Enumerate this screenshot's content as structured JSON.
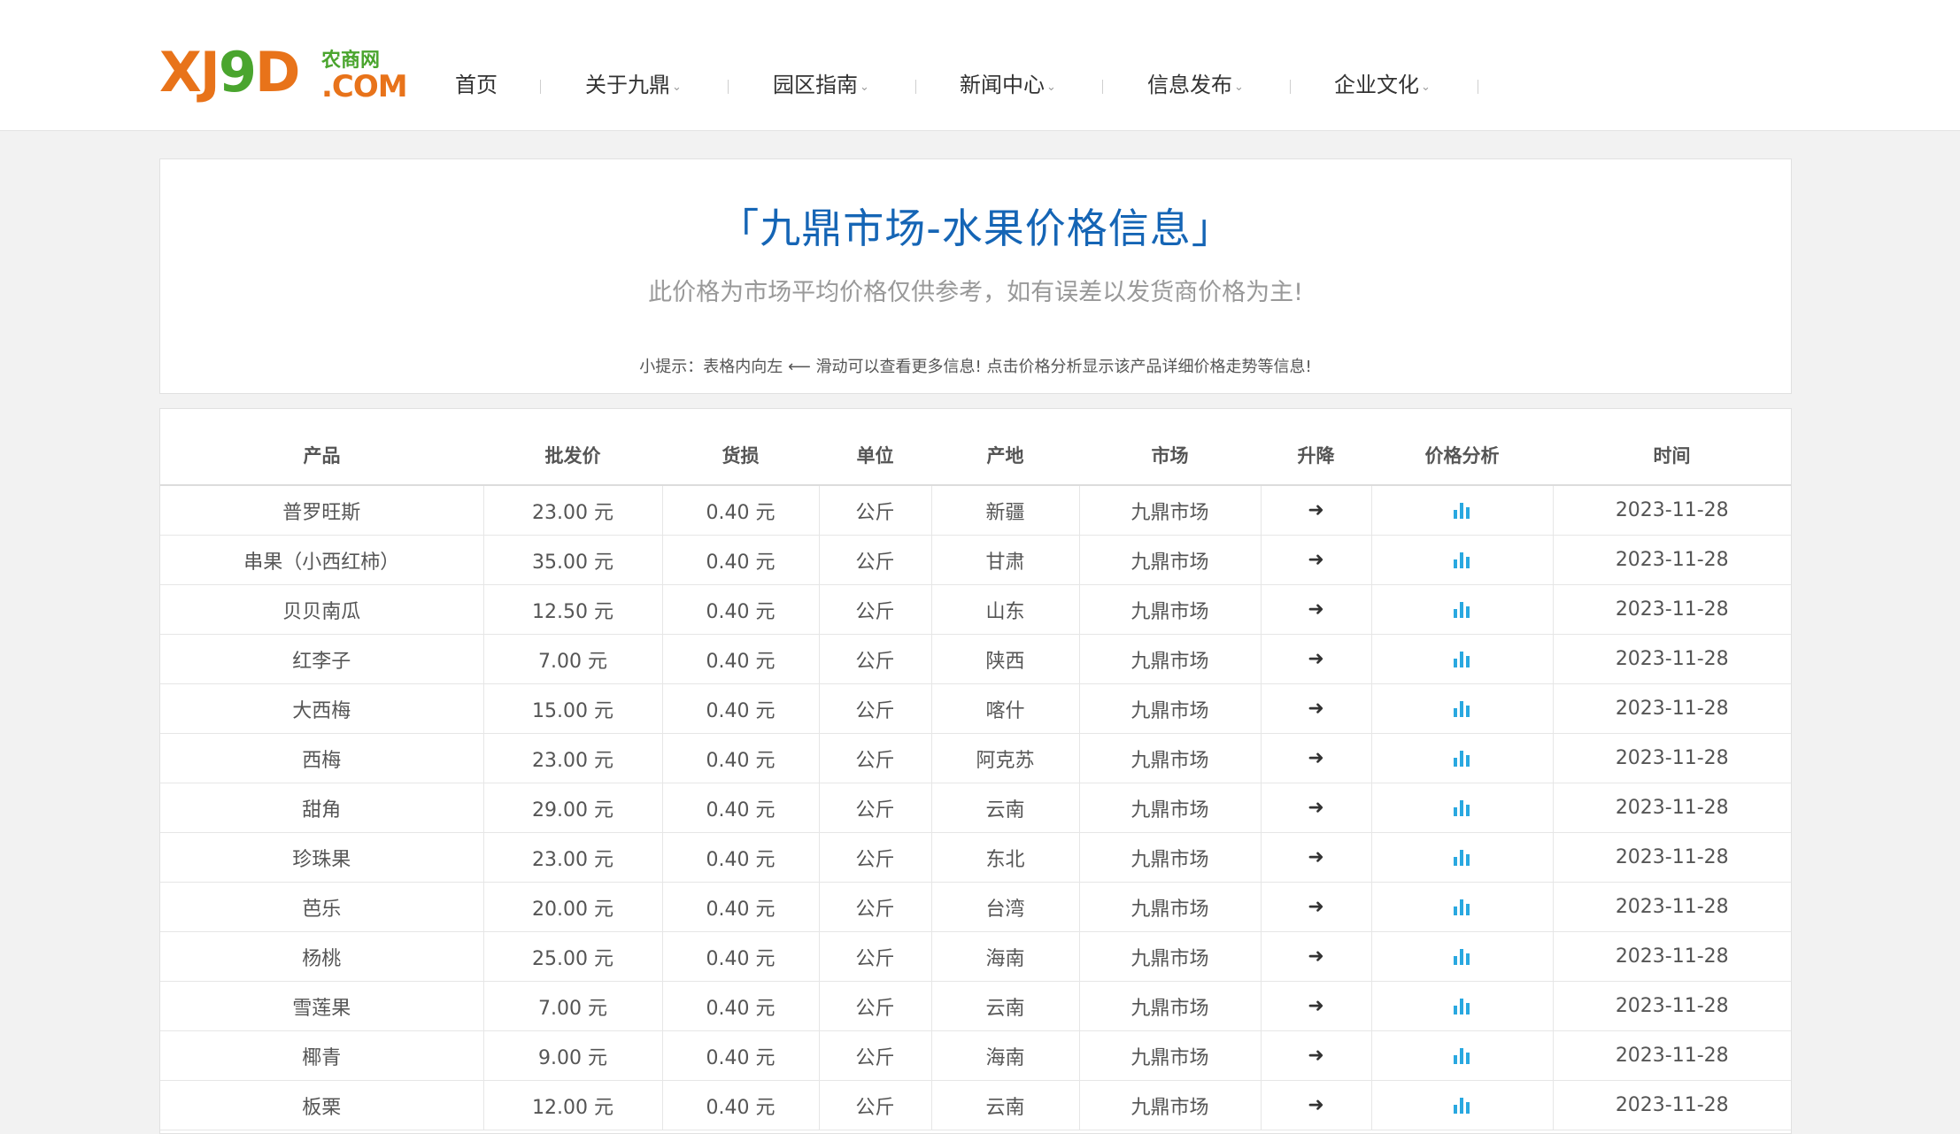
{
  "logo": {
    "main_left": "XJ",
    "main_nine": "9",
    "main_right": "D",
    "sub_top": "农商网",
    "sub_bottom": ".COM"
  },
  "nav": {
    "items": [
      {
        "label": "首页",
        "dropdown": false
      },
      {
        "label": "关于九鼎",
        "dropdown": true
      },
      {
        "label": "园区指南",
        "dropdown": true
      },
      {
        "label": "新闻中心",
        "dropdown": true
      },
      {
        "label": "信息发布",
        "dropdown": true
      },
      {
        "label": "企业文化",
        "dropdown": true
      }
    ],
    "caret": "⌄"
  },
  "header": {
    "title": "「九鼎市场-水果价格信息」",
    "subtitle": "此价格为市场平均价格仅供参考，如有误差以发货商价格为主!",
    "tip": "小提示：表格内向左 ⟵ 滑动可以查看更多信息! 点击价格分析显示该产品详细价格走势等信息!"
  },
  "table": {
    "columns": [
      "产品",
      "批发价",
      "货损",
      "单位",
      "产地",
      "市场",
      "升降",
      "价格分析",
      "时间"
    ],
    "rows": [
      {
        "product": "普罗旺斯",
        "price": "23.00 元",
        "loss": "0.40 元",
        "unit": "公斤",
        "origin": "新疆",
        "market": "九鼎市场",
        "trend": "➜",
        "date": "2023-11-28"
      },
      {
        "product": "串果（小西红柿）",
        "price": "35.00 元",
        "loss": "0.40 元",
        "unit": "公斤",
        "origin": "甘肃",
        "market": "九鼎市场",
        "trend": "➜",
        "date": "2023-11-28"
      },
      {
        "product": "贝贝南瓜",
        "price": "12.50 元",
        "loss": "0.40 元",
        "unit": "公斤",
        "origin": "山东",
        "market": "九鼎市场",
        "trend": "➜",
        "date": "2023-11-28"
      },
      {
        "product": "红李子",
        "price": "7.00 元",
        "loss": "0.40 元",
        "unit": "公斤",
        "origin": "陕西",
        "market": "九鼎市场",
        "trend": "➜",
        "date": "2023-11-28"
      },
      {
        "product": "大西梅",
        "price": "15.00 元",
        "loss": "0.40 元",
        "unit": "公斤",
        "origin": "喀什",
        "market": "九鼎市场",
        "trend": "➜",
        "date": "2023-11-28"
      },
      {
        "product": "西梅",
        "price": "23.00 元",
        "loss": "0.40 元",
        "unit": "公斤",
        "origin": "阿克苏",
        "market": "九鼎市场",
        "trend": "➜",
        "date": "2023-11-28"
      },
      {
        "product": "甜角",
        "price": "29.00 元",
        "loss": "0.40 元",
        "unit": "公斤",
        "origin": "云南",
        "market": "九鼎市场",
        "trend": "➜",
        "date": "2023-11-28"
      },
      {
        "product": "珍珠果",
        "price": "23.00 元",
        "loss": "0.40 元",
        "unit": "公斤",
        "origin": "东北",
        "market": "九鼎市场",
        "trend": "➜",
        "date": "2023-11-28"
      },
      {
        "product": "芭乐",
        "price": "20.00 元",
        "loss": "0.40 元",
        "unit": "公斤",
        "origin": "台湾",
        "market": "九鼎市场",
        "trend": "➜",
        "date": "2023-11-28"
      },
      {
        "product": "杨桃",
        "price": "25.00 元",
        "loss": "0.40 元",
        "unit": "公斤",
        "origin": "海南",
        "market": "九鼎市场",
        "trend": "➜",
        "date": "2023-11-28"
      },
      {
        "product": "雪莲果",
        "price": "7.00 元",
        "loss": "0.40 元",
        "unit": "公斤",
        "origin": "云南",
        "market": "九鼎市场",
        "trend": "➜",
        "date": "2023-11-28"
      },
      {
        "product": "椰青",
        "price": "9.00 元",
        "loss": "0.40 元",
        "unit": "公斤",
        "origin": "海南",
        "market": "九鼎市场",
        "trend": "➜",
        "date": "2023-11-28"
      },
      {
        "product": "板栗",
        "price": "12.00 元",
        "loss": "0.40 元",
        "unit": "公斤",
        "origin": "云南",
        "market": "九鼎市场",
        "trend": "➜",
        "date": "2023-11-28"
      }
    ],
    "analysis_icon": "bar-chart-icon"
  },
  "colors": {
    "title_blue": "#1565b5",
    "logo_orange": "#e8731a",
    "logo_green": "#4aa52e",
    "analysis_icon": "#29a8e0"
  }
}
